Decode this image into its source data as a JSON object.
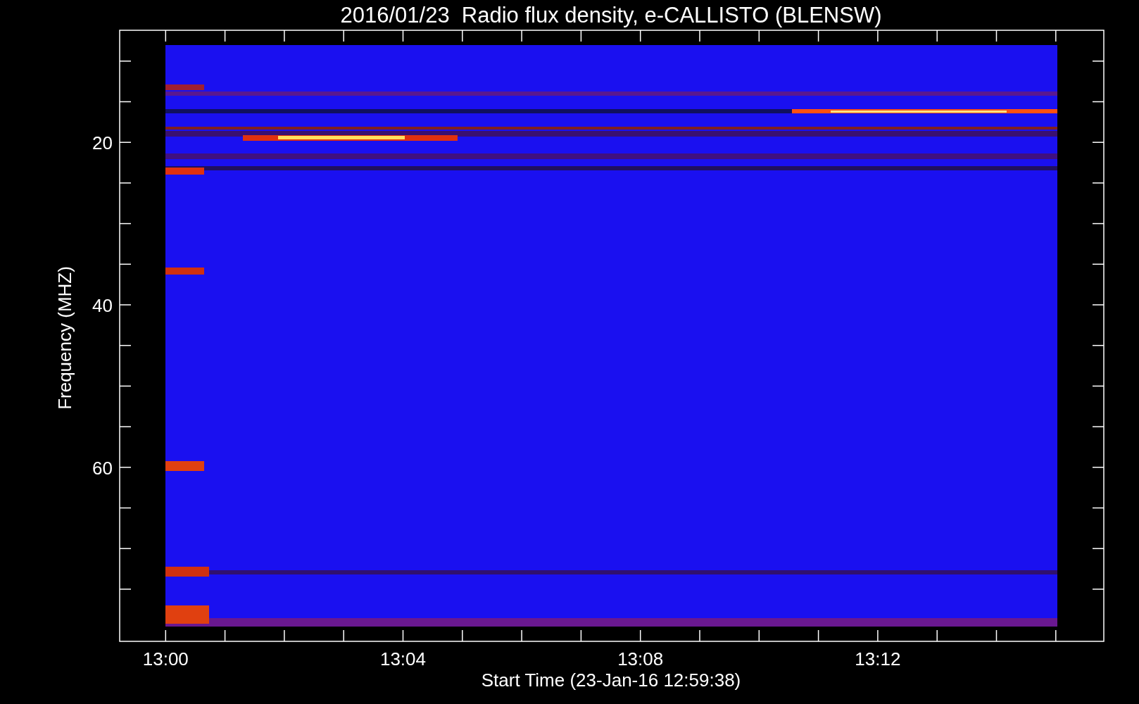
{
  "plot": {
    "title": "2016/01/23  Radio flux density, e-CALLISTO (BLENSW)",
    "x_axis": {
      "label": "Start Time (23-Jan-16 12:59:38)",
      "ticks": [
        "13:00",
        "13:04",
        "13:08",
        "13:12"
      ]
    },
    "y_axis": {
      "label": "Frequency (MHZ)",
      "ticks": [
        "20",
        "40",
        "60"
      ]
    },
    "image": {
      "kind": "spectrogram"
    }
  }
}
